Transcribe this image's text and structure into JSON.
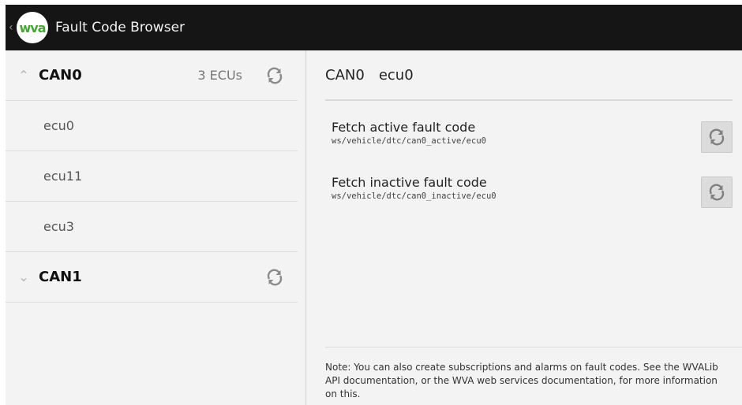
{
  "app": {
    "title": "Fault Code Browser",
    "logo_text": "wva",
    "up_icon": "chevron-left-icon"
  },
  "colors": {
    "appbar_bg": "#151515",
    "logo_green": "#4aa23a",
    "content_bg": "#f3f3f3"
  },
  "sidebar": {
    "groups": [
      {
        "name": "CAN0",
        "expanded": true,
        "count": "3 ECUs",
        "children": [
          "ecu0",
          "ecu11",
          "ecu3"
        ]
      },
      {
        "name": "CAN1",
        "expanded": false,
        "count": "",
        "children": []
      }
    ]
  },
  "detail": {
    "bus": "CAN0",
    "ecu": "ecu0",
    "rows": [
      {
        "label": "Fetch active fault code",
        "path": "ws/vehicle/dtc/can0_active/ecu0"
      },
      {
        "label": "Fetch inactive fault code",
        "path": "ws/vehicle/dtc/can0_inactive/ecu0"
      }
    ],
    "note": "Note: You can also create subscriptions and alarms on fault codes. See the WVALib API documentation, or the WVA web services documentation, for more information on this."
  }
}
